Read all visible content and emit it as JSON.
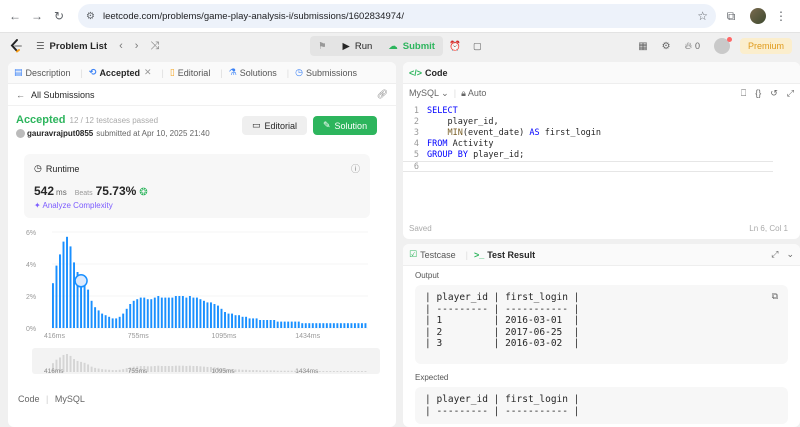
{
  "browser": {
    "url": "leetcode.com/problems/game-play-analysis-i/submissions/1602834974/"
  },
  "header": {
    "problem_list": "Problem List",
    "run": "Run",
    "submit": "Submit",
    "streak": "0",
    "premium": "Premium"
  },
  "left_tabs": [
    {
      "label": "Description",
      "icon": "description-icon"
    },
    {
      "label": "Accepted",
      "icon": "history-icon"
    },
    {
      "label": "Editorial",
      "icon": "book-icon"
    },
    {
      "label": "Solutions",
      "icon": "flask-icon"
    },
    {
      "label": "Submissions",
      "icon": "clock-icon"
    }
  ],
  "submission": {
    "back_label": "All Submissions",
    "status": "Accepted",
    "testcases": "12 / 12 testcases passed",
    "user": "gauravrajput0855",
    "submitted_at": "submitted at Apr 10, 2025 21:40",
    "editorial_btn": "Editorial",
    "solution_btn": "Solution"
  },
  "runtime": {
    "label": "Runtime",
    "value": "542",
    "unit": "ms",
    "beats_label": "Beats",
    "beats_pct": "75.73%",
    "analyze": "Analyze Complexity"
  },
  "chart_data": {
    "type": "bar",
    "ylabel": "",
    "y_ticks": [
      "6%",
      "4%",
      "2%",
      "0%"
    ],
    "ylim": [
      0,
      6
    ],
    "x_ticks": [
      "416ms",
      "755ms",
      "1095ms",
      "1434ms"
    ],
    "highlight_index": 8,
    "values": [
      2.8,
      3.9,
      4.6,
      5.4,
      5.7,
      5.1,
      4.1,
      3.5,
      3.2,
      2.9,
      2.4,
      1.7,
      1.3,
      1.1,
      0.9,
      0.8,
      0.7,
      0.6,
      0.6,
      0.7,
      0.9,
      1.2,
      1.5,
      1.7,
      1.8,
      1.9,
      1.9,
      1.8,
      1.8,
      1.9,
      2.0,
      1.9,
      1.9,
      1.9,
      1.9,
      2.0,
      2.0,
      2.0,
      1.9,
      2.0,
      1.9,
      1.9,
      1.8,
      1.7,
      1.6,
      1.6,
      1.5,
      1.4,
      1.2,
      1.0,
      0.9,
      0.9,
      0.8,
      0.8,
      0.7,
      0.7,
      0.6,
      0.6,
      0.6,
      0.5,
      0.5,
      0.5,
      0.5,
      0.5,
      0.4,
      0.4,
      0.4,
      0.4,
      0.4,
      0.4,
      0.4,
      0.3,
      0.3,
      0.3,
      0.3,
      0.3,
      0.3,
      0.3,
      0.3,
      0.3,
      0.3,
      0.3,
      0.3,
      0.3,
      0.3,
      0.3,
      0.3,
      0.3,
      0.3,
      0.3
    ],
    "mini_ticks": [
      "416ms",
      "755ms",
      "1095ms",
      "1434ms"
    ]
  },
  "code_section": {
    "label": "Code",
    "lang": "MySQL"
  },
  "editor": {
    "title": "Code",
    "lang": "MySQL",
    "mode": "Auto",
    "lines": [
      {
        "n": "1",
        "html": "<span class='kw'>SELECT</span>"
      },
      {
        "n": "2",
        "html": "    player_id,"
      },
      {
        "n": "3",
        "html": "    <span class='fn'>MIN</span>(event_date) <span class='kw'>AS</span> first_login"
      },
      {
        "n": "4",
        "html": "<span class='kw'>FROM</span> Activity"
      },
      {
        "n": "5",
        "html": "<span class='kw'>GROUP BY</span> player_id;"
      },
      {
        "n": "6",
        "html": ""
      }
    ],
    "saved": "Saved",
    "cursor": "Ln 6, Col 1"
  },
  "result": {
    "tab_testcase": "Testcase",
    "tab_result": "Test Result",
    "output_label": "Output",
    "output": "| player_id | first_login |\n| --------- | ----------- |\n| 1         | 2016-03-01  |\n| 2         | 2017-06-25  |\n| 3         | 2016-03-02  |",
    "expected_label": "Expected",
    "expected": "| player_id | first_login |\n| --------- | ----------- |"
  },
  "colors": {
    "accent_green": "#2db55d",
    "bar_blue": "#1a90ff",
    "premium": "#e09a1a"
  }
}
